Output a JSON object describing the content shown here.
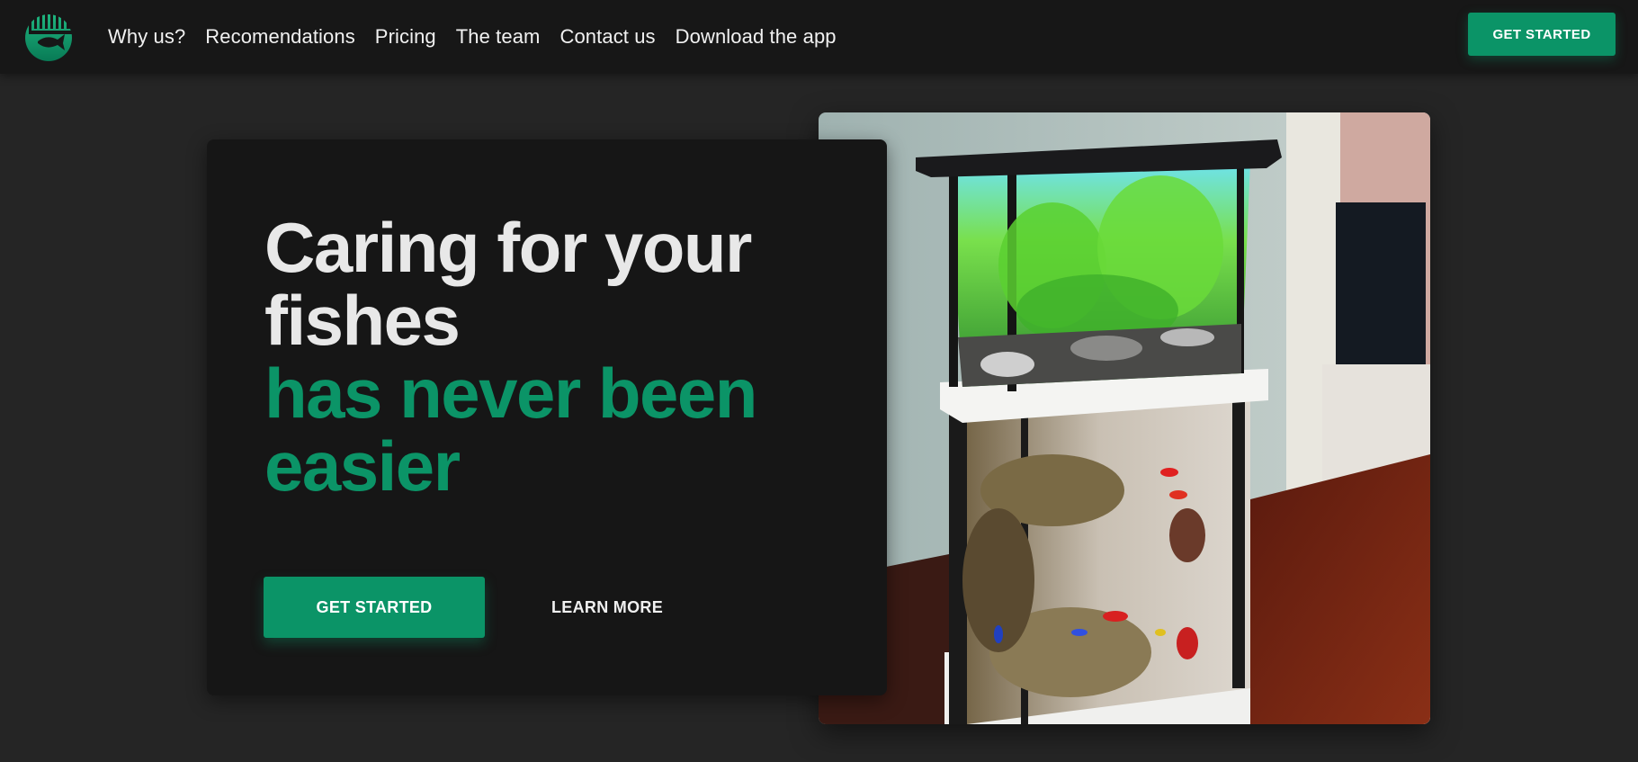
{
  "nav": {
    "logo": "fish-logo-icon",
    "links": [
      "Why us?",
      "Recomendations",
      "Pricing",
      "The team",
      "Contact us",
      "Download the app"
    ],
    "cta_label": "GET STARTED"
  },
  "hero": {
    "title_line1": "Caring for your",
    "title_line2": "fishes",
    "title_line3": "has never been",
    "title_line4": "easier",
    "primary_label": "GET STARTED",
    "secondary_label": "LEARN MORE",
    "image": "aquarium-photo"
  },
  "colors": {
    "accent": "#0b9467",
    "background": "#252525",
    "navbar": "#171717",
    "card": "#161616"
  }
}
